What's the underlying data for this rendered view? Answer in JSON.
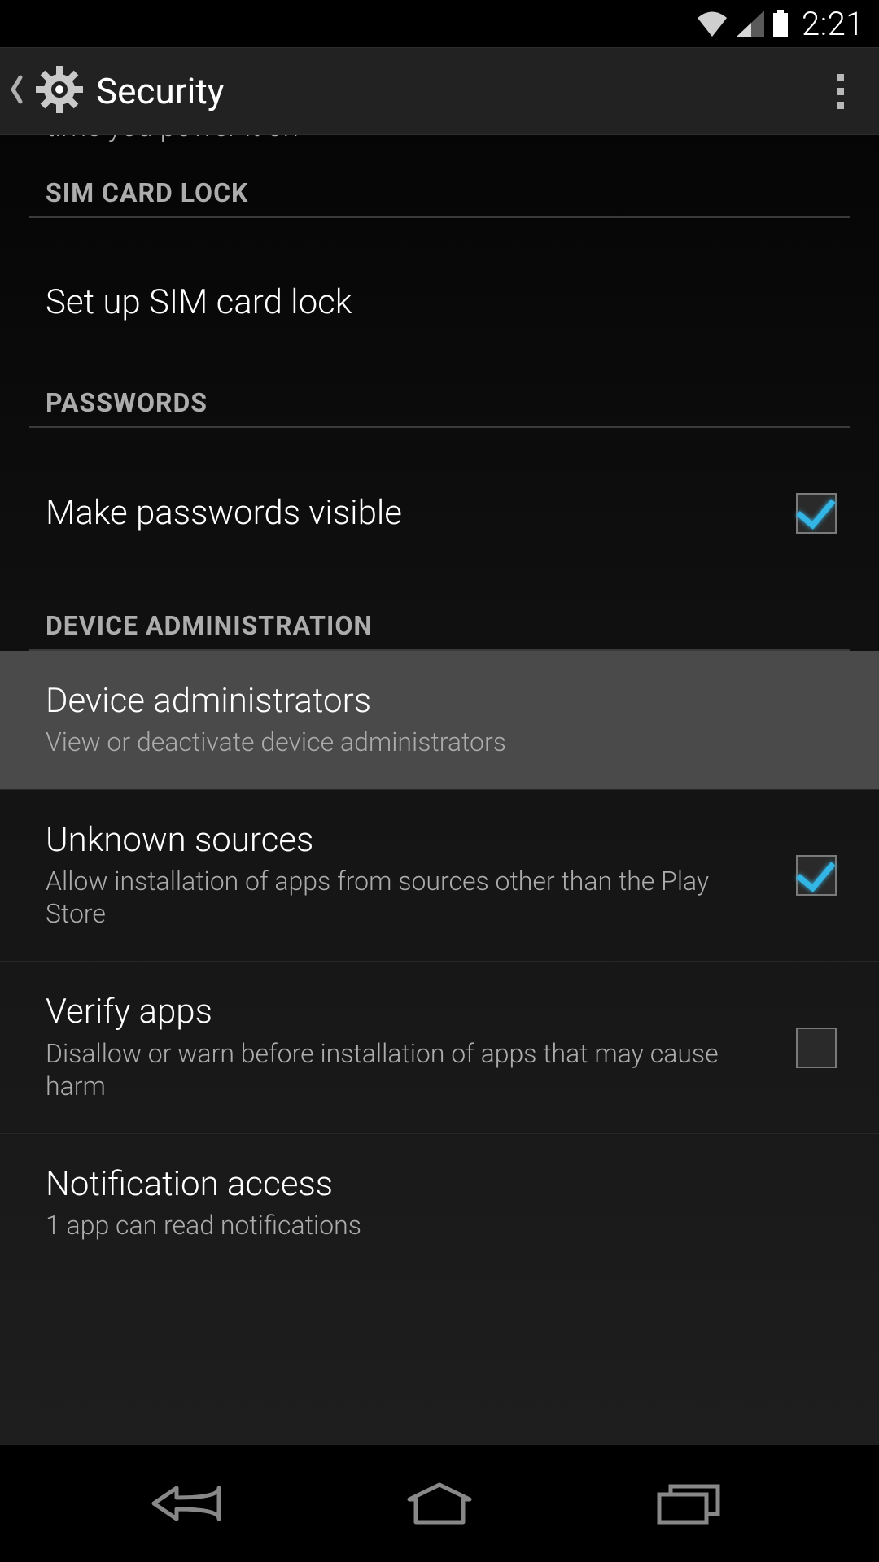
{
  "status": {
    "clock": "2:21"
  },
  "header": {
    "title": "Security"
  },
  "truncated_item": {
    "description": "Require a numeric PIN or password to decrypt your phone each time you power it on"
  },
  "sections": {
    "sim": {
      "header": "SIM CARD LOCK",
      "items": {
        "setup": {
          "title": "Set up SIM card lock"
        }
      }
    },
    "passwords": {
      "header": "PASSWORDS",
      "items": {
        "visible": {
          "title": "Make passwords visible",
          "checked": true
        }
      }
    },
    "device_admin": {
      "header": "DEVICE ADMINISTRATION",
      "items": {
        "admins": {
          "title": "Device administrators",
          "sub": "View or deactivate device administrators"
        },
        "unknown": {
          "title": "Unknown sources",
          "sub": "Allow installation of apps from sources other than the Play Store",
          "checked": true
        },
        "verify": {
          "title": "Verify apps",
          "sub": "Disallow or warn before installation of apps that may cause harm",
          "checked": false
        },
        "notif": {
          "title": "Notification access",
          "sub": "1 app can read notifications"
        }
      }
    }
  }
}
